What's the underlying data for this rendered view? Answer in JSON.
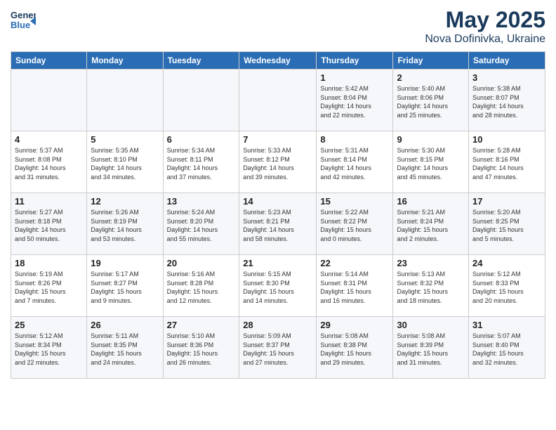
{
  "header": {
    "logo_line1": "General",
    "logo_line2": "Blue",
    "month": "May 2025",
    "location": "Nova Dofinivka, Ukraine"
  },
  "days_of_week": [
    "Sunday",
    "Monday",
    "Tuesday",
    "Wednesday",
    "Thursday",
    "Friday",
    "Saturday"
  ],
  "weeks": [
    [
      {
        "day": "",
        "info": ""
      },
      {
        "day": "",
        "info": ""
      },
      {
        "day": "",
        "info": ""
      },
      {
        "day": "",
        "info": ""
      },
      {
        "day": "1",
        "info": "Sunrise: 5:42 AM\nSunset: 8:04 PM\nDaylight: 14 hours\nand 22 minutes."
      },
      {
        "day": "2",
        "info": "Sunrise: 5:40 AM\nSunset: 8:06 PM\nDaylight: 14 hours\nand 25 minutes."
      },
      {
        "day": "3",
        "info": "Sunrise: 5:38 AM\nSunset: 8:07 PM\nDaylight: 14 hours\nand 28 minutes."
      }
    ],
    [
      {
        "day": "4",
        "info": "Sunrise: 5:37 AM\nSunset: 8:08 PM\nDaylight: 14 hours\nand 31 minutes."
      },
      {
        "day": "5",
        "info": "Sunrise: 5:35 AM\nSunset: 8:10 PM\nDaylight: 14 hours\nand 34 minutes."
      },
      {
        "day": "6",
        "info": "Sunrise: 5:34 AM\nSunset: 8:11 PM\nDaylight: 14 hours\nand 37 minutes."
      },
      {
        "day": "7",
        "info": "Sunrise: 5:33 AM\nSunset: 8:12 PM\nDaylight: 14 hours\nand 39 minutes."
      },
      {
        "day": "8",
        "info": "Sunrise: 5:31 AM\nSunset: 8:14 PM\nDaylight: 14 hours\nand 42 minutes."
      },
      {
        "day": "9",
        "info": "Sunrise: 5:30 AM\nSunset: 8:15 PM\nDaylight: 14 hours\nand 45 minutes."
      },
      {
        "day": "10",
        "info": "Sunrise: 5:28 AM\nSunset: 8:16 PM\nDaylight: 14 hours\nand 47 minutes."
      }
    ],
    [
      {
        "day": "11",
        "info": "Sunrise: 5:27 AM\nSunset: 8:18 PM\nDaylight: 14 hours\nand 50 minutes."
      },
      {
        "day": "12",
        "info": "Sunrise: 5:26 AM\nSunset: 8:19 PM\nDaylight: 14 hours\nand 53 minutes."
      },
      {
        "day": "13",
        "info": "Sunrise: 5:24 AM\nSunset: 8:20 PM\nDaylight: 14 hours\nand 55 minutes."
      },
      {
        "day": "14",
        "info": "Sunrise: 5:23 AM\nSunset: 8:21 PM\nDaylight: 14 hours\nand 58 minutes."
      },
      {
        "day": "15",
        "info": "Sunrise: 5:22 AM\nSunset: 8:22 PM\nDaylight: 15 hours\nand 0 minutes."
      },
      {
        "day": "16",
        "info": "Sunrise: 5:21 AM\nSunset: 8:24 PM\nDaylight: 15 hours\nand 2 minutes."
      },
      {
        "day": "17",
        "info": "Sunrise: 5:20 AM\nSunset: 8:25 PM\nDaylight: 15 hours\nand 5 minutes."
      }
    ],
    [
      {
        "day": "18",
        "info": "Sunrise: 5:19 AM\nSunset: 8:26 PM\nDaylight: 15 hours\nand 7 minutes."
      },
      {
        "day": "19",
        "info": "Sunrise: 5:17 AM\nSunset: 8:27 PM\nDaylight: 15 hours\nand 9 minutes."
      },
      {
        "day": "20",
        "info": "Sunrise: 5:16 AM\nSunset: 8:28 PM\nDaylight: 15 hours\nand 12 minutes."
      },
      {
        "day": "21",
        "info": "Sunrise: 5:15 AM\nSunset: 8:30 PM\nDaylight: 15 hours\nand 14 minutes."
      },
      {
        "day": "22",
        "info": "Sunrise: 5:14 AM\nSunset: 8:31 PM\nDaylight: 15 hours\nand 16 minutes."
      },
      {
        "day": "23",
        "info": "Sunrise: 5:13 AM\nSunset: 8:32 PM\nDaylight: 15 hours\nand 18 minutes."
      },
      {
        "day": "24",
        "info": "Sunrise: 5:12 AM\nSunset: 8:33 PM\nDaylight: 15 hours\nand 20 minutes."
      }
    ],
    [
      {
        "day": "25",
        "info": "Sunrise: 5:12 AM\nSunset: 8:34 PM\nDaylight: 15 hours\nand 22 minutes."
      },
      {
        "day": "26",
        "info": "Sunrise: 5:11 AM\nSunset: 8:35 PM\nDaylight: 15 hours\nand 24 minutes."
      },
      {
        "day": "27",
        "info": "Sunrise: 5:10 AM\nSunset: 8:36 PM\nDaylight: 15 hours\nand 26 minutes."
      },
      {
        "day": "28",
        "info": "Sunrise: 5:09 AM\nSunset: 8:37 PM\nDaylight: 15 hours\nand 27 minutes."
      },
      {
        "day": "29",
        "info": "Sunrise: 5:08 AM\nSunset: 8:38 PM\nDaylight: 15 hours\nand 29 minutes."
      },
      {
        "day": "30",
        "info": "Sunrise: 5:08 AM\nSunset: 8:39 PM\nDaylight: 15 hours\nand 31 minutes."
      },
      {
        "day": "31",
        "info": "Sunrise: 5:07 AM\nSunset: 8:40 PM\nDaylight: 15 hours\nand 32 minutes."
      }
    ]
  ]
}
